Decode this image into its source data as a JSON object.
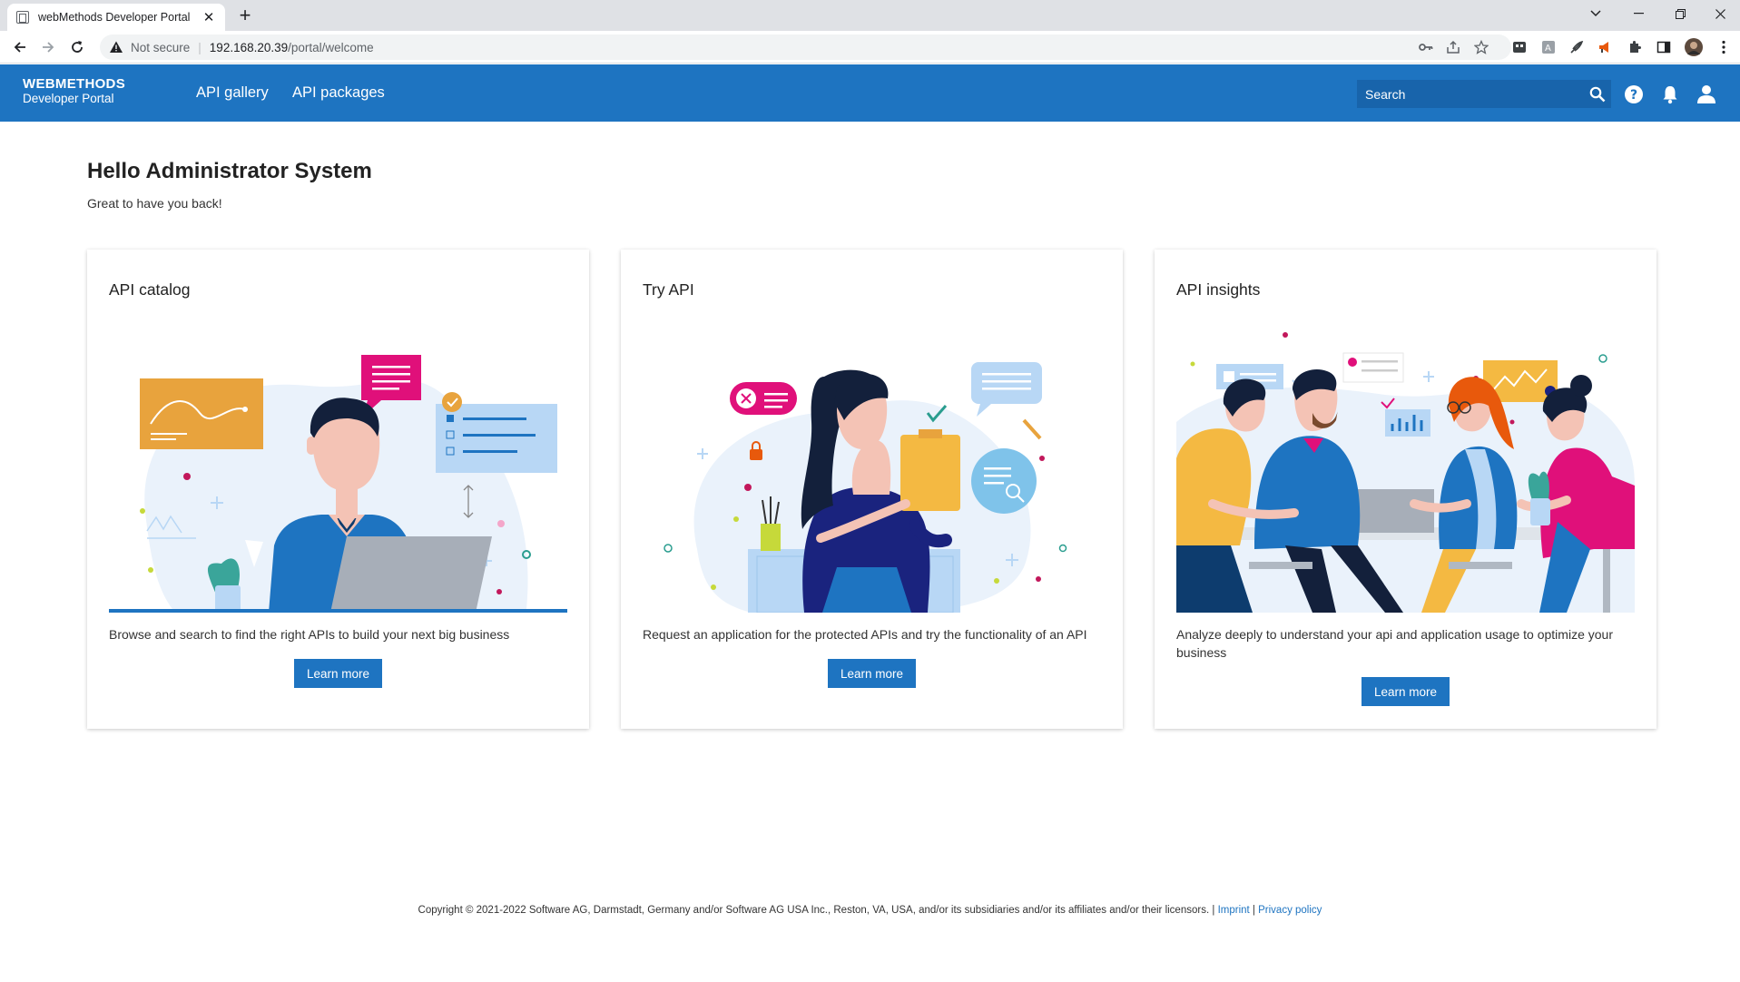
{
  "browser": {
    "tab_title": "webMethods Developer Portal",
    "security_label": "Not secure",
    "url_host": "192.168.20.39",
    "url_path": "/portal/welcome"
  },
  "header": {
    "brand_line1": "WEBMETHODS",
    "brand_line2": "Developer Portal",
    "nav": [
      "API gallery",
      "API packages"
    ],
    "search_placeholder": "Search"
  },
  "main": {
    "greeting": "Hello Administrator System",
    "subgreeting": "Great to have you back!",
    "cards": [
      {
        "title": "API catalog",
        "description": "Browse and search to find the right APIs to build your next big business",
        "button": "Learn more"
      },
      {
        "title": "Try API",
        "description": "Request an application for the protected APIs and try the functionality of an API",
        "button": "Learn more"
      },
      {
        "title": "API insights",
        "description": "Analyze deeply to understand your api and application usage to optimize your business",
        "button": "Learn more"
      }
    ]
  },
  "footer": {
    "copyright": "Copyright © 2021-2022 Software AG, Darmstadt, Germany and/or Software AG USA Inc., Reston, VA, USA, and/or its subsidiaries and/or its affiliates and/or their licensors.",
    "separator": "|",
    "imprint": "Imprint",
    "privacy": "Privacy policy"
  },
  "colors": {
    "brand_blue": "#1e74c1",
    "search_bg": "#1864ab",
    "accent_magenta": "#e0107a",
    "accent_orange": "#e8a33d"
  }
}
